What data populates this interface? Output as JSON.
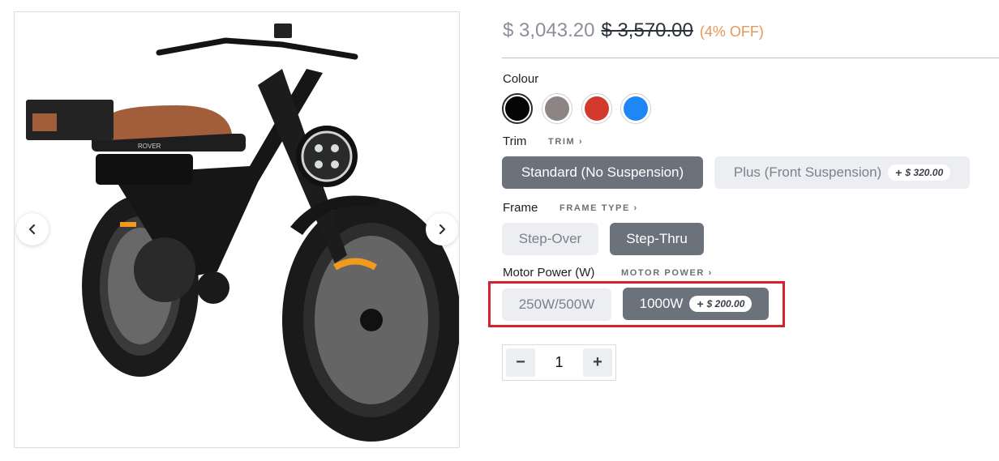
{
  "price": {
    "sale": "$ 3,043.20",
    "regular": "$ 3,570.00",
    "discount": "(4% OFF)"
  },
  "colour": {
    "label": "Colour",
    "swatches": [
      {
        "name": "black",
        "hex": "#050505",
        "selected": true
      },
      {
        "name": "grey",
        "hex": "#8d8583",
        "selected": false
      },
      {
        "name": "red",
        "hex": "#d33a2e",
        "selected": false
      },
      {
        "name": "blue",
        "hex": "#1f87f5",
        "selected": false
      }
    ]
  },
  "trim": {
    "label": "Trim",
    "link": "TRIM ›",
    "options": [
      {
        "label": "Standard (No Suspension)",
        "selected": true,
        "addon": ""
      },
      {
        "label": "Plus (Front Suspension)",
        "selected": false,
        "addon": "$ 320.00"
      }
    ]
  },
  "frame": {
    "label": "Frame",
    "link": "FRAME TYPE ›",
    "options": [
      {
        "label": "Step-Over",
        "selected": false
      },
      {
        "label": "Step-Thru",
        "selected": true
      }
    ]
  },
  "motor": {
    "label": "Motor Power (W)",
    "link": "MOTOR POWER ›",
    "options": [
      {
        "label": "250W/500W",
        "selected": false,
        "addon": ""
      },
      {
        "label": "1000W",
        "selected": true,
        "addon": "$ 200.00"
      }
    ]
  },
  "quantity": {
    "value": "1",
    "minus": "−",
    "plus": "+"
  },
  "gallery": {
    "badge": "ROVER"
  }
}
